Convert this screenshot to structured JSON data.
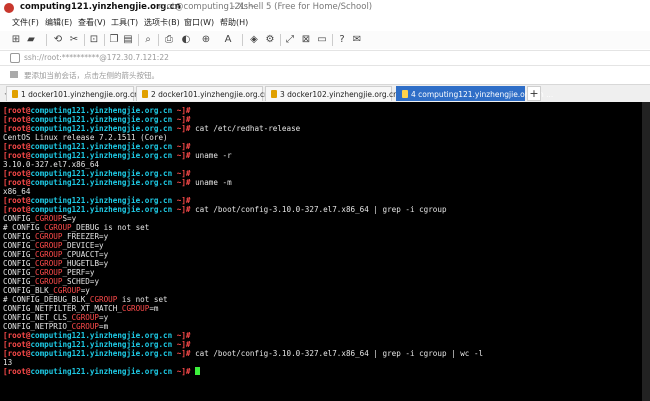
{
  "window": {
    "title_main": "computing121.yinzhengjie.org.cn",
    "title_sub": "root@computing121:~",
    "title_app": "- Xshell 5 (Free for Home/School)"
  },
  "menu": [
    "文件(F)",
    "编辑(E)",
    "查看(V)",
    "工具(T)",
    "选项卡(B)",
    "窗口(W)",
    "帮助(H)"
  ],
  "address": "ssh://root:**********@172.30.7.121:22",
  "hint": "要添加当前会话，点击左侧的箭头按钮。",
  "tabs": [
    {
      "label": "1 docker101.yinzhengjie.org.cn"
    },
    {
      "label": "2 docker101.yinzhengjie.org.cn"
    },
    {
      "label": "3 docker102.yinzhengjie.org.cn"
    },
    {
      "label": "4 computing121.yinzhengjie.org.cn ..."
    }
  ],
  "prompt": {
    "user": "root",
    "host": "computing121.yinzhengjie.org.cn",
    "dir": "~"
  },
  "terminal": [
    {
      "kind": "prompt",
      "cmd": ""
    },
    {
      "kind": "prompt",
      "cmd": ""
    },
    {
      "kind": "prompt",
      "cmd": "cat /etc/redhat-release"
    },
    {
      "kind": "out",
      "text": "CentOS Linux release 7.2.1511 (Core)"
    },
    {
      "kind": "prompt",
      "cmd": ""
    },
    {
      "kind": "prompt",
      "cmd": "uname -r"
    },
    {
      "kind": "out",
      "text": "3.10.0-327.el7.x86_64"
    },
    {
      "kind": "prompt",
      "cmd": ""
    },
    {
      "kind": "prompt",
      "cmd": "uname -m"
    },
    {
      "kind": "out",
      "text": "x86_64"
    },
    {
      "kind": "prompt",
      "cmd": ""
    },
    {
      "kind": "prompt",
      "cmd": "cat /boot/config-3.10.0-327.el7.x86_64 | grep -i cgroup"
    },
    {
      "kind": "hl",
      "pre": "CONFIG_",
      "hl": "CGROUP",
      "post": "S=y"
    },
    {
      "kind": "hl",
      "pre": "# CONFIG_",
      "hl": "CGROUP",
      "post": "_DEBUG is not set"
    },
    {
      "kind": "hl",
      "pre": "CONFIG_",
      "hl": "CGROUP",
      "post": "_FREEZER=y"
    },
    {
      "kind": "hl",
      "pre": "CONFIG_",
      "hl": "CGROUP",
      "post": "_DEVICE=y"
    },
    {
      "kind": "hl",
      "pre": "CONFIG_",
      "hl": "CGROUP",
      "post": "_CPUACCT=y"
    },
    {
      "kind": "hl",
      "pre": "CONFIG_",
      "hl": "CGROUP",
      "post": "_HUGETLB=y"
    },
    {
      "kind": "hl",
      "pre": "CONFIG_",
      "hl": "CGROUP",
      "post": "_PERF=y"
    },
    {
      "kind": "hl",
      "pre": "CONFIG_",
      "hl": "CGROUP",
      "post": "_SCHED=y"
    },
    {
      "kind": "hl",
      "pre": "CONFIG_BLK_",
      "hl": "CGROUP",
      "post": "=y"
    },
    {
      "kind": "hl",
      "pre": "# CONFIG_DEBUG_BLK_",
      "hl": "CGROUP",
      "post": " is not set"
    },
    {
      "kind": "hl",
      "pre": "CONFIG_NETFILTER_XT_MATCH_",
      "hl": "CGROUP",
      "post": "=m"
    },
    {
      "kind": "hl",
      "pre": "CONFIG_NET_CLS_",
      "hl": "CGROUP",
      "post": "=y"
    },
    {
      "kind": "hl",
      "pre": "CONFIG_NETPRIO_",
      "hl": "CGROUP",
      "post": "=m"
    },
    {
      "kind": "prompt",
      "cmd": ""
    },
    {
      "kind": "prompt",
      "cmd": ""
    },
    {
      "kind": "prompt",
      "cmd": "cat /boot/config-3.10.0-327.el7.x86_64 | grep -i cgroup | wc -l"
    },
    {
      "kind": "out",
      "text": "13"
    },
    {
      "kind": "prompt",
      "cmd": "",
      "cursor": true
    }
  ],
  "colors": {
    "terminal_bg": "#000000",
    "prompt_red": "#ff4b4b",
    "prompt_cyan": "#1ecbe6",
    "active_tab": "#2f6ec7",
    "cursor_green": "#3cf03c"
  }
}
